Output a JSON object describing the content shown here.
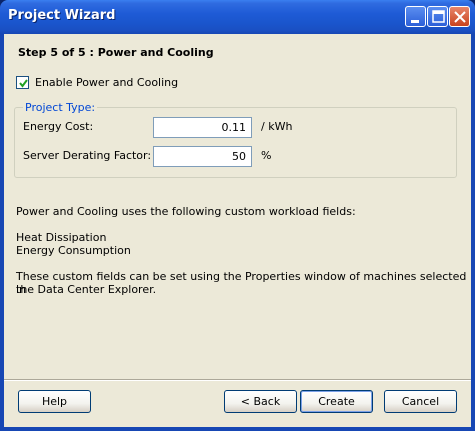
{
  "window": {
    "title": "Project Wizard"
  },
  "wizard": {
    "step_title": "Step 5 of 5 : Power and Cooling",
    "enable_checkbox": {
      "label": "Enable Power and Cooling",
      "checked": true
    },
    "project_type": {
      "legend": "Project Type:",
      "energy_cost": {
        "label": "Energy Cost:",
        "value": "0.11",
        "unit": "/ kWh"
      },
      "derating": {
        "label": "Server Derating Factor:",
        "value": "50",
        "unit": "%"
      }
    },
    "info": {
      "intro": "Power and Cooling uses the following custom workload fields:",
      "fields": [
        "Heat Dissipation",
        "Energy Consumption"
      ],
      "note_line1": "These custom fields can be set using the Properties window of machines selected in",
      "note_line2": "the Data Center Explorer."
    }
  },
  "buttons": {
    "help": "Help",
    "back": "< Back",
    "create": "Create",
    "cancel": "Cancel"
  },
  "colors": {
    "titlebar": "#1A55CC",
    "group_legend": "#0046D5",
    "dialog_bg": "#ECE9D8"
  }
}
